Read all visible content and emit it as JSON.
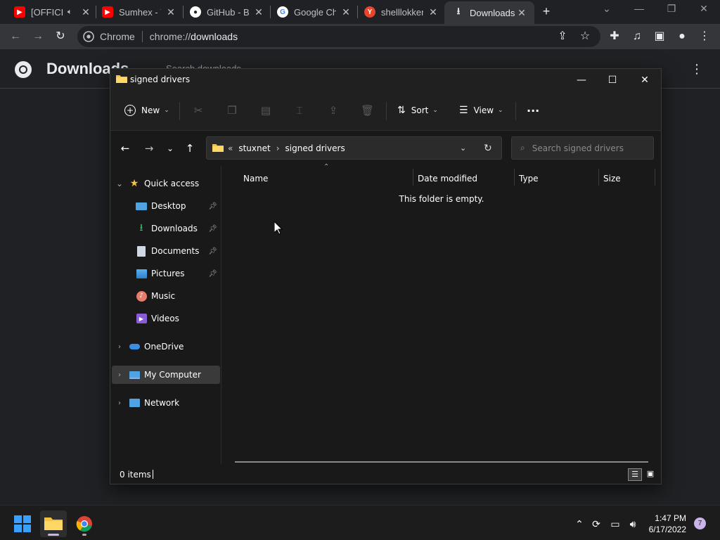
{
  "browser": {
    "tabs": [
      {
        "title": "[OFFICIAL VIDEO]",
        "favicon": "youtube-icon",
        "color": "#ff0000",
        "extra": "speaker"
      },
      {
        "title": "Sumhex - YouTube",
        "favicon": "youtube-icon",
        "color": "#ff0000"
      },
      {
        "title": "GitHub - BlackSnufkin",
        "favicon": "github-icon",
        "color": "#ffffff"
      },
      {
        "title": "Google Chrome",
        "favicon": "google-icon",
        "color": "#4285f4"
      },
      {
        "title": "shelllokker",
        "favicon": "y-icon",
        "color": "#e8452c"
      },
      {
        "title": "Downloads",
        "favicon": "download-icon",
        "color": "#e8eaed"
      }
    ],
    "omnibox": {
      "site": "Chrome",
      "url_prefix": "chrome://",
      "url_path": "downloads"
    }
  },
  "downloads_page": {
    "title": "Downloads",
    "search_placeholder": "Search downloads"
  },
  "explorer": {
    "title": "signed drivers",
    "cmd": {
      "new_label": "New",
      "sort_label": "Sort",
      "view_label": "View",
      "more_label": "···"
    },
    "address": {
      "crumb_overflow": "«",
      "crumbs": [
        "stuxnet",
        "signed drivers"
      ]
    },
    "search_placeholder": "Search signed drivers",
    "nav": {
      "quick_access": "Quick access",
      "items": [
        "Desktop",
        "Downloads",
        "Documents",
        "Pictures",
        "Music",
        "Videos"
      ],
      "onedrive": "OneDrive",
      "my_computer": "My Computer",
      "network": "Network"
    },
    "columns": [
      "Name",
      "Date modified",
      "Type",
      "Size"
    ],
    "empty_message": "This folder is empty.",
    "status": "0 items"
  },
  "taskbar": {
    "time": "1:47 PM",
    "date": "6/17/2022",
    "notifications": "7"
  }
}
